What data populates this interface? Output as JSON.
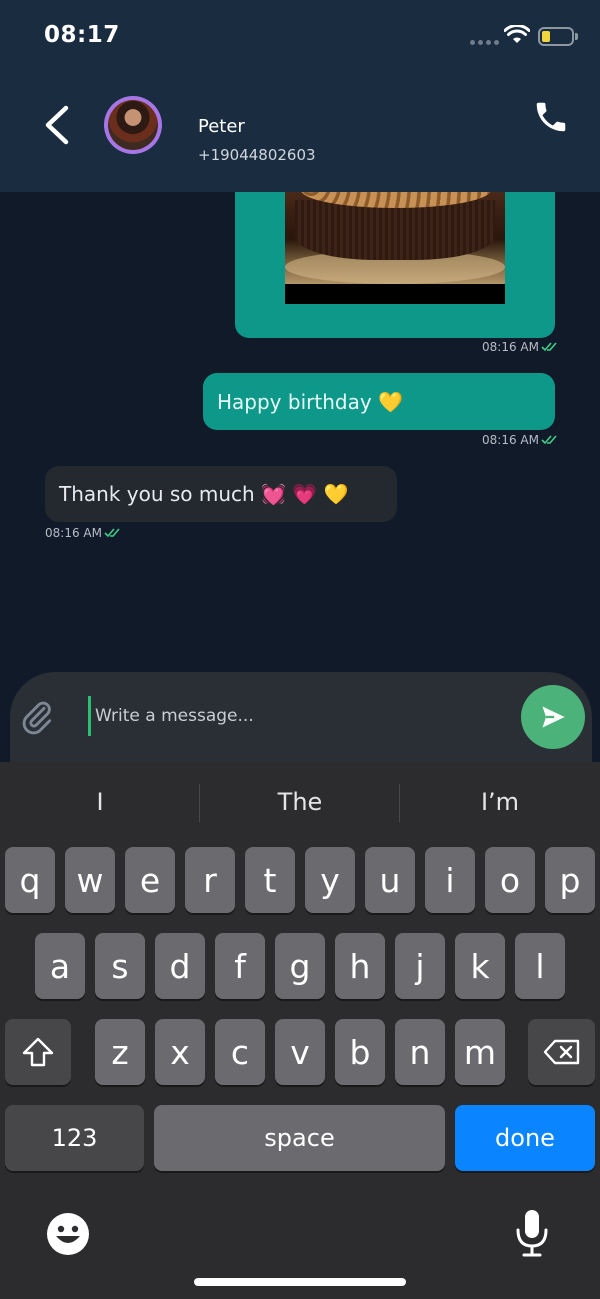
{
  "status_bar": {
    "time": "08:17"
  },
  "header": {
    "contact_name": "Peter",
    "contact_phone": "+19044802603"
  },
  "messages": [
    {
      "type": "image",
      "direction": "outgoing",
      "time": "08:16 AM"
    },
    {
      "type": "text",
      "direction": "outgoing",
      "text": "Happy birthday 💛",
      "time": "08:16 AM"
    },
    {
      "type": "text",
      "direction": "incoming",
      "text": "Thank you so much 💓 💗 💛",
      "time": "08:16 AM"
    }
  ],
  "composer": {
    "placeholder": "Write a message...",
    "value": ""
  },
  "keyboard": {
    "suggestions": [
      "I",
      "The",
      "I’m"
    ],
    "row1": [
      "q",
      "w",
      "e",
      "r",
      "t",
      "y",
      "u",
      "i",
      "o",
      "p"
    ],
    "row2": [
      "a",
      "s",
      "d",
      "f",
      "g",
      "h",
      "j",
      "k",
      "l"
    ],
    "row3": [
      "z",
      "x",
      "c",
      "v",
      "b",
      "n",
      "m"
    ],
    "numbers_key": "123",
    "space_key": "space",
    "done_key": "done"
  },
  "colors": {
    "header_bg": "#1a2c40",
    "chat_bg": "#111a29",
    "outgoing_bubble": "#0e988a",
    "incoming_bubble": "#24292f",
    "send_button": "#4bb37a",
    "done_key": "#0a84ff",
    "read_check": "#3fcf86"
  },
  "icons": [
    "back-chevron",
    "phone",
    "paperclip",
    "send",
    "emoji",
    "microphone",
    "shift",
    "backspace",
    "wifi",
    "battery",
    "double-check"
  ]
}
